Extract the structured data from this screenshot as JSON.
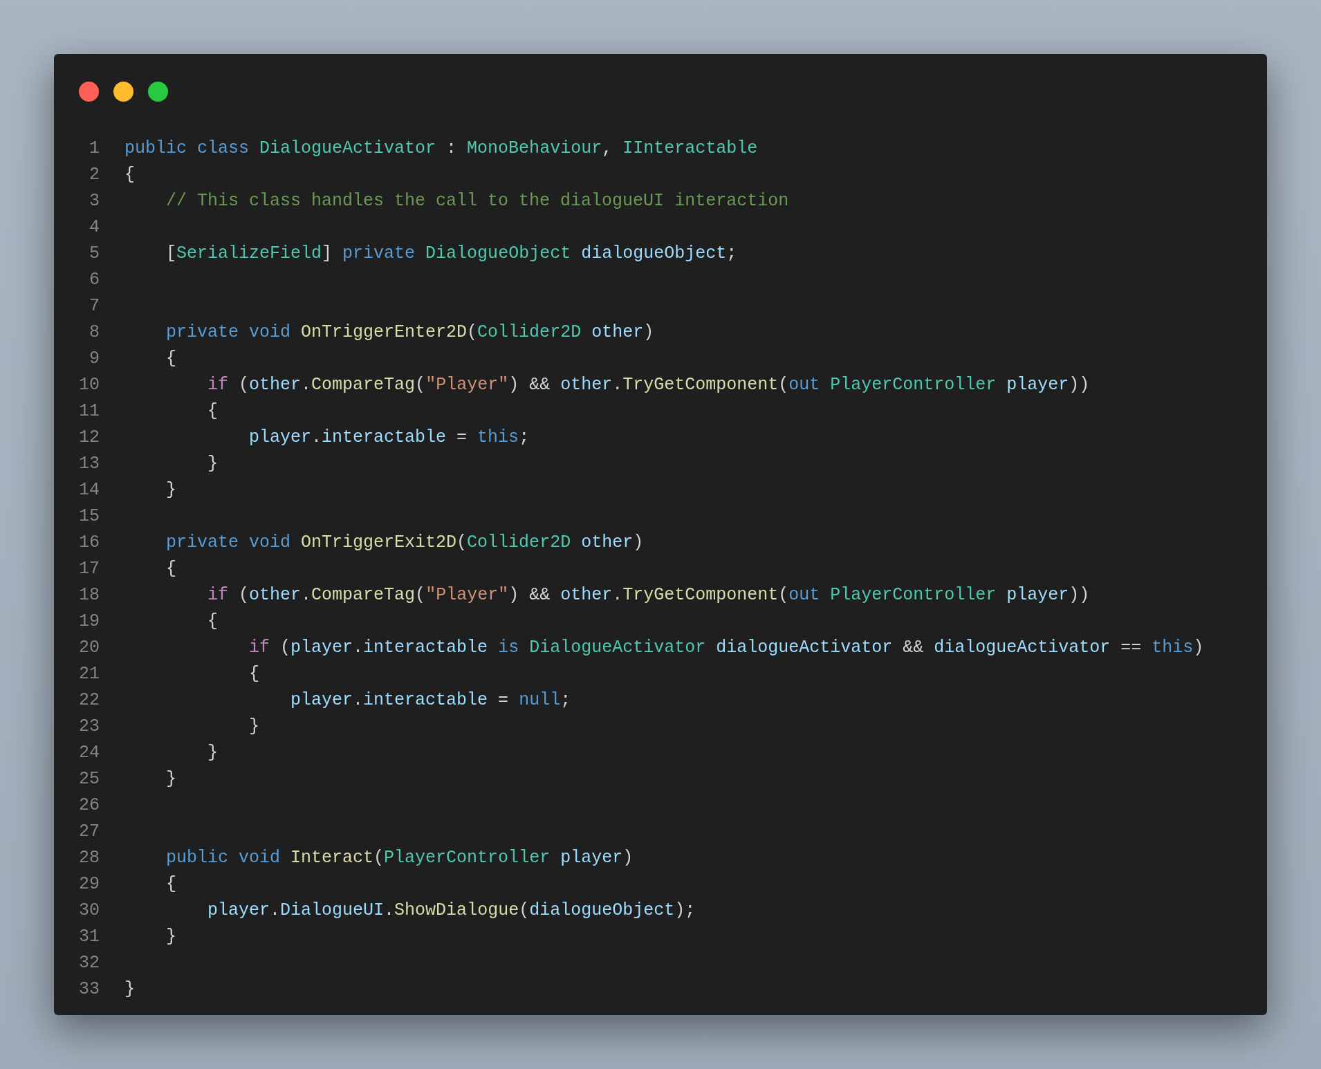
{
  "window": {
    "controls": [
      {
        "kind": "close"
      },
      {
        "kind": "minimize"
      },
      {
        "kind": "maximize"
      }
    ]
  },
  "lines": [
    {
      "number": "1",
      "tokens": [
        {
          "text": "public class ",
          "kind": "kw"
        },
        {
          "text": "DialogueActivator",
          "kind": "type"
        },
        {
          "text": " : ",
          "kind": "p"
        },
        {
          "text": "MonoBehaviour",
          "kind": "type"
        },
        {
          "text": ", ",
          "kind": "p"
        },
        {
          "text": "IInteractable",
          "kind": "type"
        }
      ]
    },
    {
      "number": "2",
      "tokens": [
        {
          "text": "{",
          "kind": "p"
        }
      ]
    },
    {
      "number": "3",
      "tokens": [
        {
          "text": "    // This class handles the call to the dialogueUI interaction",
          "kind": "cm"
        }
      ]
    },
    {
      "number": "4"
    },
    {
      "number": "5",
      "tokens": [
        {
          "text": "    [",
          "kind": "p"
        },
        {
          "text": "SerializeField",
          "kind": "type"
        },
        {
          "text": "] ",
          "kind": "p"
        },
        {
          "text": "private ",
          "kind": "kw"
        },
        {
          "text": "DialogueObject ",
          "kind": "type"
        },
        {
          "text": "dialogueObject",
          "kind": "var"
        },
        {
          "text": ";",
          "kind": "p"
        }
      ]
    },
    {
      "number": "6"
    },
    {
      "number": "7"
    },
    {
      "number": "8",
      "tokens": [
        {
          "text": "    private void ",
          "kind": "kw"
        },
        {
          "text": "OnTriggerEnter2D",
          "kind": "fn"
        },
        {
          "text": "(",
          "kind": "p"
        },
        {
          "text": "Collider2D ",
          "kind": "type"
        },
        {
          "text": "other",
          "kind": "var"
        },
        {
          "text": ")",
          "kind": "p"
        }
      ]
    },
    {
      "number": "9",
      "tokens": [
        {
          "text": "    {",
          "kind": "p"
        }
      ]
    },
    {
      "number": "10",
      "tokens": [
        {
          "text": "        if",
          "kind": "ctl"
        },
        {
          "text": " (",
          "kind": "p"
        },
        {
          "text": "other",
          "kind": "var"
        },
        {
          "text": ".",
          "kind": "p"
        },
        {
          "text": "CompareTag",
          "kind": "fn"
        },
        {
          "text": "(",
          "kind": "p"
        },
        {
          "text": "\"Player\"",
          "kind": "str"
        },
        {
          "text": ") && ",
          "kind": "p"
        },
        {
          "text": "other",
          "kind": "var"
        },
        {
          "text": ".",
          "kind": "p"
        },
        {
          "text": "TryGetComponent",
          "kind": "fn"
        },
        {
          "text": "(",
          "kind": "p"
        },
        {
          "text": "out ",
          "kind": "kw"
        },
        {
          "text": "PlayerController ",
          "kind": "type"
        },
        {
          "text": "player",
          "kind": "var"
        },
        {
          "text": "))",
          "kind": "p"
        }
      ]
    },
    {
      "number": "11",
      "tokens": [
        {
          "text": "        {",
          "kind": "p"
        }
      ]
    },
    {
      "number": "12",
      "tokens": [
        {
          "text": "            player",
          "kind": "var"
        },
        {
          "text": ".",
          "kind": "p"
        },
        {
          "text": "interactable",
          "kind": "var"
        },
        {
          "text": " = ",
          "kind": "p"
        },
        {
          "text": "this",
          "kind": "kw"
        },
        {
          "text": ";",
          "kind": "p"
        }
      ]
    },
    {
      "number": "13",
      "tokens": [
        {
          "text": "        }",
          "kind": "p"
        }
      ]
    },
    {
      "number": "14",
      "tokens": [
        {
          "text": "    }",
          "kind": "p"
        }
      ]
    },
    {
      "number": "15"
    },
    {
      "number": "16",
      "tokens": [
        {
          "text": "    private void ",
          "kind": "kw"
        },
        {
          "text": "OnTriggerExit2D",
          "kind": "fn"
        },
        {
          "text": "(",
          "kind": "p"
        },
        {
          "text": "Collider2D ",
          "kind": "type"
        },
        {
          "text": "other",
          "kind": "var"
        },
        {
          "text": ")",
          "kind": "p"
        }
      ]
    },
    {
      "number": "17",
      "tokens": [
        {
          "text": "    {",
          "kind": "p"
        }
      ]
    },
    {
      "number": "18",
      "tokens": [
        {
          "text": "        if",
          "kind": "ctl"
        },
        {
          "text": " (",
          "kind": "p"
        },
        {
          "text": "other",
          "kind": "var"
        },
        {
          "text": ".",
          "kind": "p"
        },
        {
          "text": "CompareTag",
          "kind": "fn"
        },
        {
          "text": "(",
          "kind": "p"
        },
        {
          "text": "\"Player\"",
          "kind": "str"
        },
        {
          "text": ") && ",
          "kind": "p"
        },
        {
          "text": "other",
          "kind": "var"
        },
        {
          "text": ".",
          "kind": "p"
        },
        {
          "text": "TryGetComponent",
          "kind": "fn"
        },
        {
          "text": "(",
          "kind": "p"
        },
        {
          "text": "out ",
          "kind": "kw"
        },
        {
          "text": "PlayerController ",
          "kind": "type"
        },
        {
          "text": "player",
          "kind": "var"
        },
        {
          "text": "))",
          "kind": "p"
        }
      ]
    },
    {
      "number": "19",
      "tokens": [
        {
          "text": "        {",
          "kind": "p"
        }
      ]
    },
    {
      "number": "20",
      "tokens": [
        {
          "text": "            if",
          "kind": "ctl"
        },
        {
          "text": " (",
          "kind": "p"
        },
        {
          "text": "player",
          "kind": "var"
        },
        {
          "text": ".",
          "kind": "p"
        },
        {
          "text": "interactable",
          "kind": "var"
        },
        {
          "text": " is ",
          "kind": "kw"
        },
        {
          "text": "DialogueActivator ",
          "kind": "type"
        },
        {
          "text": "dialogueActivator",
          "kind": "var"
        },
        {
          "text": " && ",
          "kind": "p"
        },
        {
          "text": "dialogueActivator",
          "kind": "var"
        },
        {
          "text": " == ",
          "kind": "p"
        },
        {
          "text": "this",
          "kind": "kw"
        },
        {
          "text": ")",
          "kind": "p"
        }
      ]
    },
    {
      "number": "21",
      "tokens": [
        {
          "text": "            {",
          "kind": "p"
        }
      ]
    },
    {
      "number": "22",
      "tokens": [
        {
          "text": "                player",
          "kind": "var"
        },
        {
          "text": ".",
          "kind": "p"
        },
        {
          "text": "interactable",
          "kind": "var"
        },
        {
          "text": " = ",
          "kind": "p"
        },
        {
          "text": "null",
          "kind": "kw"
        },
        {
          "text": ";",
          "kind": "p"
        }
      ]
    },
    {
      "number": "23",
      "tokens": [
        {
          "text": "            }",
          "kind": "p"
        }
      ]
    },
    {
      "number": "24",
      "tokens": [
        {
          "text": "        }",
          "kind": "p"
        }
      ]
    },
    {
      "number": "25",
      "tokens": [
        {
          "text": "    }",
          "kind": "p"
        }
      ]
    },
    {
      "number": "26"
    },
    {
      "number": "27"
    },
    {
      "number": "28",
      "tokens": [
        {
          "text": "    public void ",
          "kind": "kw"
        },
        {
          "text": "Interact",
          "kind": "fn"
        },
        {
          "text": "(",
          "kind": "p"
        },
        {
          "text": "PlayerController ",
          "kind": "type"
        },
        {
          "text": "player",
          "kind": "var"
        },
        {
          "text": ")",
          "kind": "p"
        }
      ]
    },
    {
      "number": "29",
      "tokens": [
        {
          "text": "    {",
          "kind": "p"
        }
      ]
    },
    {
      "number": "30",
      "tokens": [
        {
          "text": "        player",
          "kind": "var"
        },
        {
          "text": ".",
          "kind": "p"
        },
        {
          "text": "DialogueUI",
          "kind": "var"
        },
        {
          "text": ".",
          "kind": "p"
        },
        {
          "text": "ShowDialogue",
          "kind": "fn"
        },
        {
          "text": "(",
          "kind": "p"
        },
        {
          "text": "dialogueObject",
          "kind": "var"
        },
        {
          "text": ");",
          "kind": "p"
        }
      ]
    },
    {
      "number": "31",
      "tokens": [
        {
          "text": "    }",
          "kind": "p"
        }
      ]
    },
    {
      "number": "32"
    },
    {
      "number": "33",
      "tokens": [
        {
          "text": "}",
          "kind": "p"
        }
      ]
    }
  ]
}
